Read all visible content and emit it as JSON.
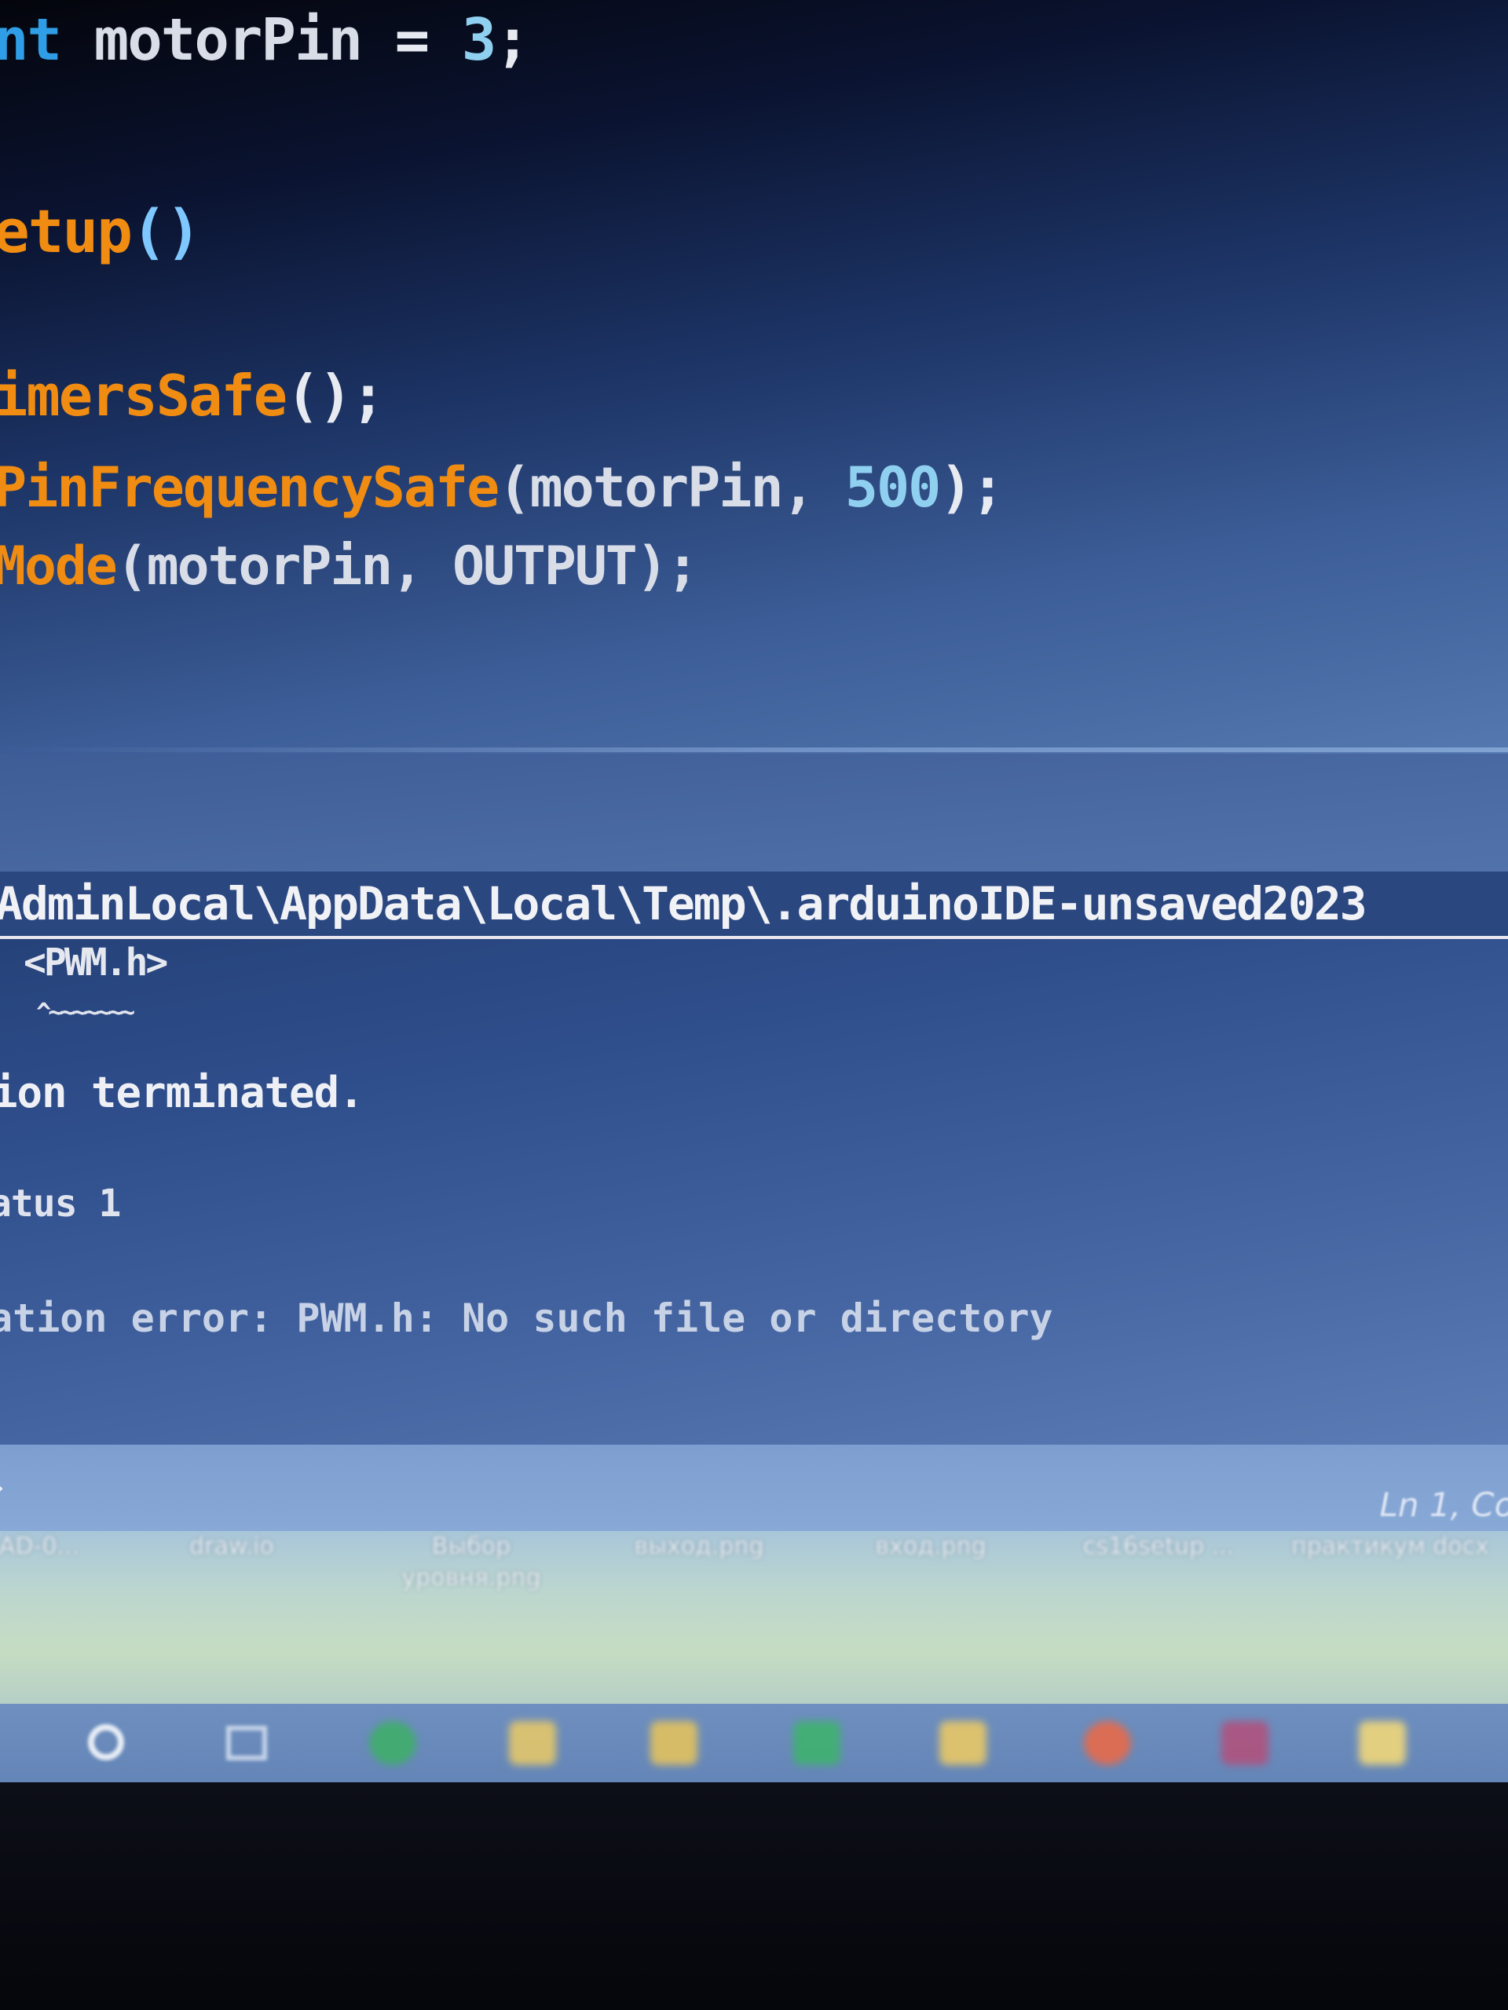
{
  "editor": {
    "lines": [
      [
        {
          "t": "nt",
          "c": "kw"
        },
        {
          "t": " motorPin ",
          "c": "id"
        },
        {
          "t": "= ",
          "c": "pu"
        },
        {
          "t": "3",
          "c": "num"
        },
        {
          "t": ";",
          "c": "pu"
        }
      ],
      [
        {
          "t": "etup",
          "c": "fn"
        },
        {
          "t": "()",
          "c": "br"
        }
      ],
      [
        {
          "t": "imersSafe",
          "c": "fn"
        },
        {
          "t": "();",
          "c": "pu"
        }
      ],
      [
        {
          "t": "PinFrequencySafe",
          "c": "fn"
        },
        {
          "t": "(motorPin, ",
          "c": "id"
        },
        {
          "t": "500",
          "c": "num"
        },
        {
          "t": ");",
          "c": "pu"
        }
      ],
      [
        {
          "t": "Mode",
          "c": "fn"
        },
        {
          "t": "(motorPin, OUTPUT);",
          "c": "id"
        }
      ]
    ]
  },
  "output": {
    "path": "AdminLocal\\AppData\\Local\\Temp\\.arduinoIDE-unsaved2023",
    "include": "<PWM.h>",
    "caret": "^~~~~~~~",
    "terminated": "ion terminated.",
    "status": "atus 1",
    "error": "ation error: PWM.h: No such file or directory"
  },
  "statusbar": {
    "position": "Ln 1, Col"
  },
  "desktop": {
    "items": [
      {
        "label": "AD-0...",
        "color": "#f6f8fb"
      },
      {
        "label": "draw.io",
        "color": "#f6f8fb"
      },
      {
        "label": "Выбор уровня.png",
        "color": "#f6f8fb"
      },
      {
        "label": "выход.png",
        "color": "#f6f8fb"
      },
      {
        "label": "вход.png",
        "color": "#f6f8fb"
      },
      {
        "label": "cs16setup ...",
        "color": "#f6f8fb"
      },
      {
        "label": "практикум docx",
        "color": "#f6f8fb"
      }
    ]
  },
  "taskbar": {
    "icons": [
      {
        "name": "edge-icon",
        "color": "#3fae6a"
      },
      {
        "name": "file-explorer-icon",
        "color": "#e4c76a"
      },
      {
        "name": "store-icon",
        "color": "#e3c25e"
      },
      {
        "name": "mail-icon",
        "color": "#3fb26f"
      },
      {
        "name": "folder-icon",
        "color": "#e9c866"
      },
      {
        "name": "chrome-icon",
        "color": "#e86a4a"
      },
      {
        "name": "discord-icon",
        "color": "#b0527e"
      },
      {
        "name": "notes-icon",
        "color": "#f0d77a"
      }
    ]
  }
}
